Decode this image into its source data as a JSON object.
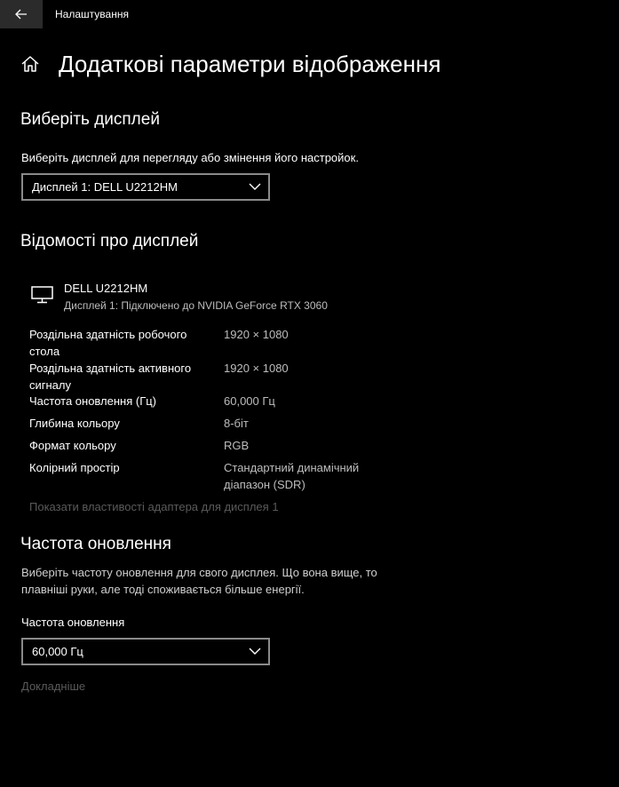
{
  "window": {
    "title": "Налаштування"
  },
  "page": {
    "title": "Додаткові параметри відображення"
  },
  "choose_display": {
    "heading": "Виберіть дисплей",
    "description": "Виберіть дисплей для перегляду або змінення його настройок.",
    "selected": "Дисплей 1: DELL U2212HM"
  },
  "display_info": {
    "heading": "Відомості про дисплей",
    "monitor_name": "DELL U2212HM",
    "monitor_subtitle": "Дисплей 1: Підключено до NVIDIA GeForce RTX 3060",
    "rows": [
      {
        "label": "Роздільна здатність робочого стола",
        "value": "1920 × 1080"
      },
      {
        "label": "Роздільна здатність активного сигналу",
        "value": "1920 × 1080"
      },
      {
        "label": "Частота оновлення (Гц)",
        "value": "60,000 Гц"
      },
      {
        "label": "Глибина кольору",
        "value": "8-біт"
      },
      {
        "label": "Формат кольору",
        "value": "RGB"
      },
      {
        "label": "Колірний простір",
        "value": "Стандартний динамічний діапазон (SDR)"
      }
    ],
    "adapter_link": "Показати властивості адаптера для дисплея 1"
  },
  "refresh_rate": {
    "heading": "Частота оновлення",
    "description": "Виберіть частоту оновлення для свого дисплея. Що вона вище, то плавніші руки, але тоді споживається більше енергії.",
    "field_label": "Частота оновлення",
    "selected": "60,000 Гц",
    "more_link": "Докладніше"
  },
  "colors": {
    "background": "#000000",
    "text": "#ffffff",
    "muted": "#5a5a5a",
    "border": "#8a8a8a"
  }
}
